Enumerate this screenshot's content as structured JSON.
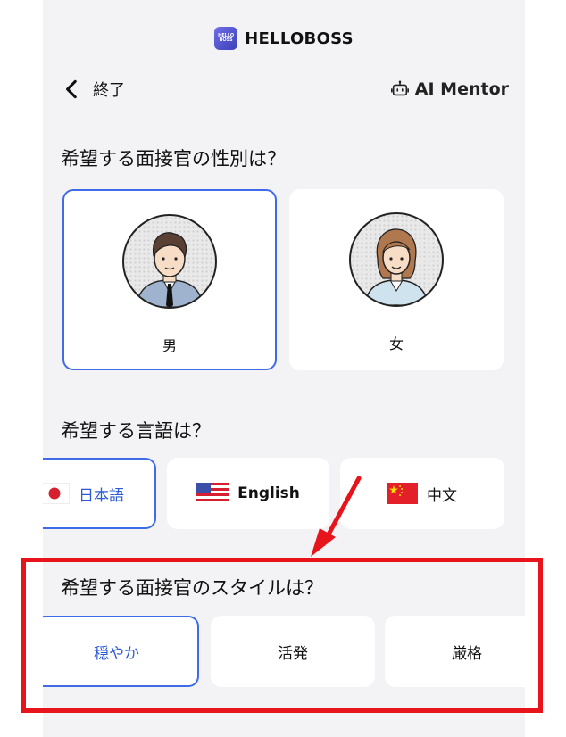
{
  "app": {
    "brand_name": "HELLOBOSS",
    "logo_text_top": "HELLO",
    "logo_text_bottom": "BOSS"
  },
  "header": {
    "back_label": "終了",
    "mentor_label": "AI Mentor"
  },
  "gender_section": {
    "title": "希望する面接官の性別は？",
    "options": [
      {
        "label": "男",
        "selected": true
      },
      {
        "label": "女",
        "selected": false
      }
    ]
  },
  "language_section": {
    "title": "希望する言語は？",
    "options": [
      {
        "label": "日本語",
        "flag": "japan-flag-icon",
        "selected": true
      },
      {
        "label": "English",
        "flag": "usa-flag-icon",
        "selected": false
      },
      {
        "label": "中文",
        "flag": "china-flag-icon",
        "selected": false
      }
    ]
  },
  "style_section": {
    "title": "希望する面接官のスタイルは？",
    "options": [
      {
        "label": "穏やか",
        "selected": true
      },
      {
        "label": "活発",
        "selected": false
      },
      {
        "label": "厳格",
        "selected": false
      }
    ]
  },
  "colors": {
    "accent": "#3f6be8",
    "annotation": "#e8141b",
    "background": "#f3f3f5"
  }
}
